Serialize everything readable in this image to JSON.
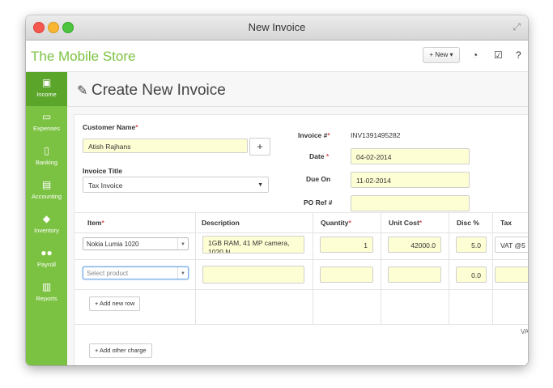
{
  "window": {
    "title": "New Invoice"
  },
  "app": {
    "brand": "The Mobile Store",
    "new_button": "+ New ▾"
  },
  "sidebar": {
    "items": [
      {
        "label": "Income",
        "icon": "money-icon"
      },
      {
        "label": "Expenses",
        "icon": "credit-card-icon"
      },
      {
        "label": "Banking",
        "icon": "banking-icon"
      },
      {
        "label": "Accounting",
        "icon": "book-icon"
      },
      {
        "label": "Inventory",
        "icon": "tag-icon"
      },
      {
        "label": "Payroll",
        "icon": "users-icon"
      },
      {
        "label": "Reports",
        "icon": "bar-chart-icon"
      }
    ],
    "active": "Income"
  },
  "page": {
    "title": "Create New Invoice"
  },
  "form": {
    "customer_name_label": "Customer Name",
    "customer_name_value": "Atish Rajhans",
    "invoice_title_label": "Invoice Title",
    "invoice_title_value": "Tax Invoice",
    "invoice_no_label": "Invoice #",
    "invoice_no_value": "INV1391495282",
    "date_label": "Date",
    "date_value": "04-02-2014",
    "due_on_label": "Due On",
    "due_on_value": "11-02-2014",
    "po_ref_label": "PO Ref #",
    "po_ref_value": "",
    "required_mark": "*"
  },
  "table": {
    "headers": {
      "item": "Item",
      "description": "Description",
      "quantity": "Quantity",
      "unit_cost": "Unit Cost",
      "disc": "Disc %",
      "tax": "Tax"
    },
    "rows": [
      {
        "item": "Nokia Lumia 1020",
        "description": "1GB RAM, 41 MP camera, 1020 N...",
        "quantity": "1",
        "unit_cost": "42000.0",
        "disc": "5.0",
        "tax": "VAT @5"
      },
      {
        "item_placeholder": "Select product",
        "description": "",
        "quantity": "",
        "unit_cost": "",
        "disc": "0.0",
        "tax": ""
      }
    ],
    "add_row": "+ Add new row",
    "trailing_text": "VA",
    "add_charge": "+ Add other charge"
  }
}
